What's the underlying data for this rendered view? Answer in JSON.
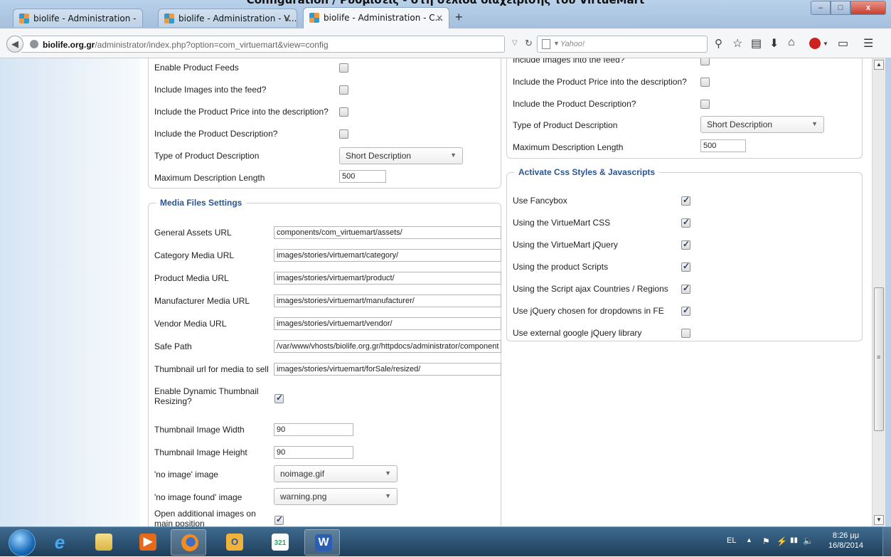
{
  "page_heading": "Configuration / Ρυθμίσεις - στη σελίδα διαχείρισης του VirtueMart",
  "browser": {
    "tabs": [
      {
        "label": "biolife - Administration -",
        "active": false
      },
      {
        "label": "biolife - Administration - V...",
        "active": false
      },
      {
        "label": "biolife - Administration - C...",
        "active": true
      }
    ],
    "tab_close_icon": "×",
    "new_tab_icon": "+",
    "window_buttons": {
      "minimize": "–",
      "maximize": "□",
      "close": "x"
    },
    "url_host": "biolife.org.gr",
    "url_path": "/administrator/index.php?option=com_virtuemart&view=config",
    "search_placeholder": "Yahoo!",
    "accent_color": "#2a5592"
  },
  "left_panel": {
    "title": "",
    "rows": [
      {
        "label": "Enable Product Feeds",
        "type": "checkbox",
        "checked": false
      },
      {
        "label": "Include Images into the feed?",
        "type": "checkbox",
        "checked": false
      },
      {
        "label": "Include the Product Price into the description?",
        "type": "checkbox",
        "checked": false
      },
      {
        "label": "Include the Product Description?",
        "type": "checkbox",
        "checked": false
      },
      {
        "label": "Type of Product Description",
        "type": "select",
        "value": "Short Description"
      },
      {
        "label": "Maximum Description Length",
        "type": "text",
        "value": "500"
      }
    ]
  },
  "media_panel": {
    "title": "Media Files Settings",
    "general_assets_url": {
      "label": "General Assets URL",
      "value": "components/com_virtuemart/assets/"
    },
    "category_media_url": {
      "label": "Category Media URL",
      "value": "images/stories/virtuemart/category/"
    },
    "product_media_url": {
      "label": "Product Media URL",
      "value": "images/stories/virtuemart/product/"
    },
    "manufacturer_media_url": {
      "label": "Manufacturer Media URL",
      "value": "images/stories/virtuemart/manufacturer/"
    },
    "vendor_media_url": {
      "label": "Vendor Media URL",
      "value": "images/stories/virtuemart/vendor/"
    },
    "safe_path": {
      "label": "Safe Path",
      "value": "/var/www/vhosts/biolife.org.gr/httpdocs/administrator/component"
    },
    "thumbnail_url": {
      "label": "Thumbnail url for media to sell",
      "value": "images/stories/virtuemart/forSale/resized/"
    },
    "dynamic_thumb": {
      "label": "Enable Dynamic Thumbnail Resizing?",
      "checked": true
    },
    "thumb_width": {
      "label": "Thumbnail Image Width",
      "value": "90"
    },
    "thumb_height": {
      "label": "Thumbnail Image Height",
      "value": "90"
    },
    "no_image": {
      "label": "'no image' image",
      "value": "noimage.gif"
    },
    "no_image_found": {
      "label": "'no image found' image",
      "value": "warning.png"
    },
    "open_additional": {
      "label": "Open additional images on main position",
      "checked": true
    }
  },
  "right_top_panel": {
    "rows": [
      {
        "label": "Include Images into the feed?",
        "type": "checkbox",
        "checked": false
      },
      {
        "label": "Include the Product Price into the description?",
        "type": "checkbox",
        "checked": false
      },
      {
        "label": "Include the Product Description?",
        "type": "checkbox",
        "checked": false
      },
      {
        "label": "Type of Product Description",
        "type": "select",
        "value": "Short Description"
      },
      {
        "label": "Maximum Description Length",
        "type": "text",
        "value": "500"
      }
    ]
  },
  "css_panel": {
    "title": "Activate Css Styles & Javascripts",
    "rows": [
      {
        "label": "Use Fancybox",
        "checked": true
      },
      {
        "label": "Using the VirtueMart CSS",
        "checked": true
      },
      {
        "label": "Using the VirtueMart jQuery",
        "checked": true
      },
      {
        "label": "Using the product Scripts",
        "checked": true
      },
      {
        "label": "Using the Script ajax Countries / Regions",
        "checked": true
      },
      {
        "label": "Use jQuery chosen for dropdowns in FE",
        "checked": true
      },
      {
        "label": "Use external google jQuery library",
        "checked": false
      }
    ]
  },
  "taskbar": {
    "apps": [
      "start",
      "ie",
      "explorer",
      "media",
      "firefox",
      "outlook",
      "calendar",
      "word"
    ],
    "calendar_text": "321",
    "lang": "EL",
    "time": "8:26 μμ",
    "date": "16/8/2014"
  }
}
